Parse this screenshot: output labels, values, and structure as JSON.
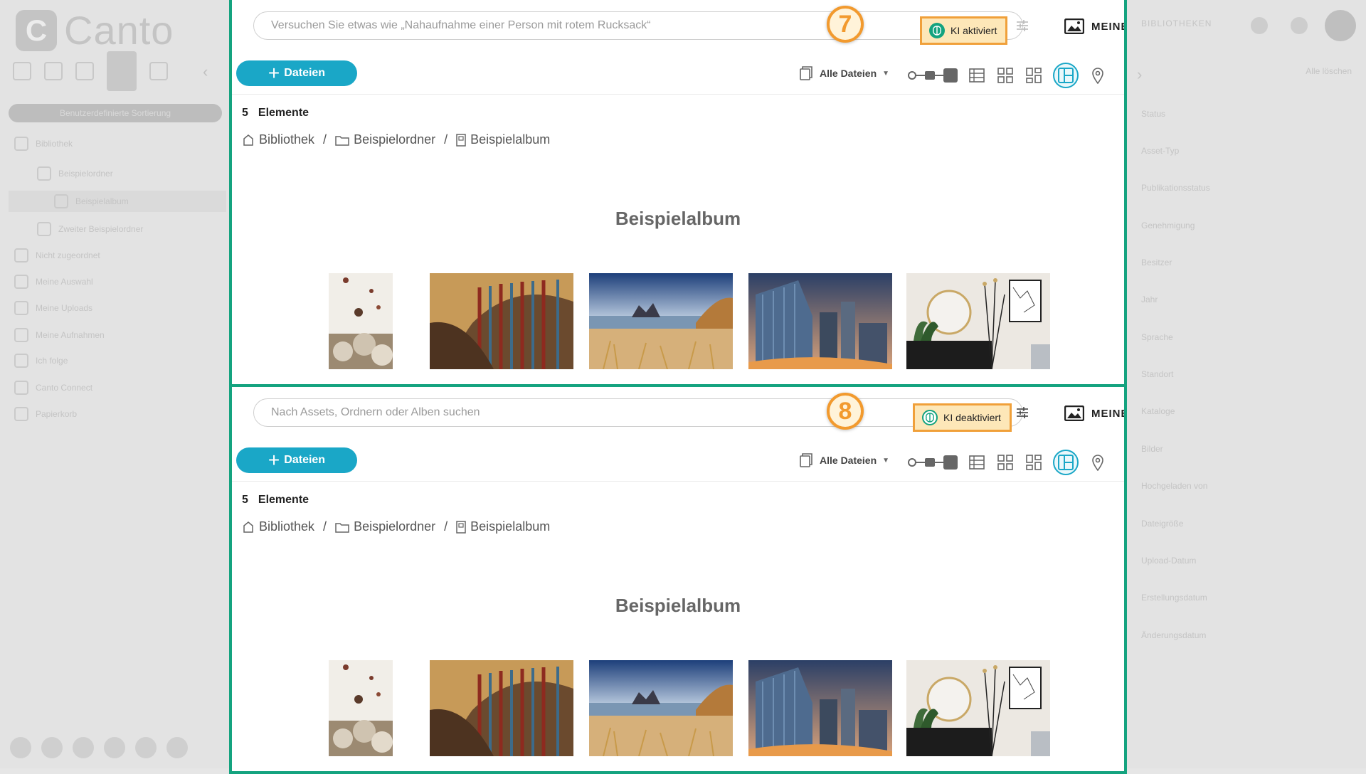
{
  "sidebar": {
    "logo_mark": "C",
    "logo_text": "Canto",
    "pill": "Benutzerdefinierte Sortierung",
    "items": [
      {
        "label": "Bibliothek"
      },
      {
        "label": "Beispielordner"
      },
      {
        "label": "Beispielalbum"
      },
      {
        "label": "Zweiter Beispielordner"
      },
      {
        "label": "Nicht zugeordnet"
      },
      {
        "label": "Meine Auswahl"
      },
      {
        "label": "Meine Uploads"
      },
      {
        "label": "Meine Aufnahmen"
      },
      {
        "label": "Ich folge"
      },
      {
        "label": "Canto Connect"
      },
      {
        "label": "Papierkorb"
      }
    ]
  },
  "rightpanel": {
    "title": "BIBLIOTHEKEN",
    "alle": "Alle löschen",
    "items": [
      "Status",
      "Asset-Typ",
      "Publikationsstatus",
      "Genehmigung",
      "Besitzer",
      "Jahr",
      "Sprache",
      "Standort",
      "Kataloge",
      "Bilder",
      "Hochgeladen von",
      "Dateigröße",
      "Upload-Datum",
      "Erstellungsdatum",
      "Änderungsdatum"
    ]
  },
  "panels": [
    {
      "search_placeholder": "Versuchen Sie etwas wie „Nahaufnahme einer Person mit rotem Rucksack“",
      "ki_label": "KI aktiviert",
      "badge": "7"
    },
    {
      "search_placeholder": "Nach Assets, Ordnern oder Alben suchen",
      "ki_label": "KI deaktiviert",
      "badge": "8"
    }
  ],
  "common": {
    "meine_label": "MEINE",
    "upload_label": "Dateien",
    "filter_label": "Alle Dateien",
    "count_num": "5",
    "count_label": "Elemente",
    "breadcrumb": [
      "Bibliothek",
      "Beispielordner",
      "Beispielalbum"
    ],
    "album_title": "Beispielalbum",
    "thumbnails": [
      "balloons-photo",
      "library-photo",
      "beach-photo",
      "city-photo",
      "interior-photo"
    ]
  },
  "colors": {
    "accent": "#1aa7c7",
    "panel_border": "#14a37f",
    "highlight_bg": "#fde7b8",
    "highlight_border": "#f0a03a",
    "badge": "#f29a2e"
  }
}
